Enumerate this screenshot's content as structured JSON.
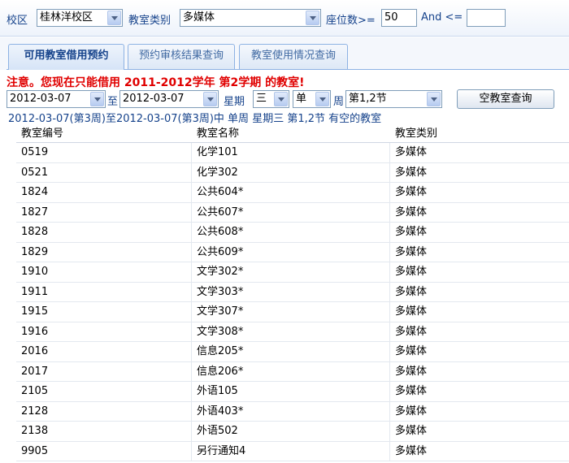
{
  "filters": {
    "campus_label": "校区",
    "campus_value": "桂林洋校区",
    "room_type_label": "教室类别",
    "room_type_value": "多媒体",
    "seats_label": "座位数>=",
    "seats_min": "50",
    "and_label": "And <=",
    "seats_max": ""
  },
  "tabs": [
    {
      "label": "可用教室借用预约",
      "active": true
    },
    {
      "label": "预约审核结果查询",
      "active": false
    },
    {
      "label": "教室使用情况查询",
      "active": false
    }
  ],
  "notice": "注意。您现在只能借用 2011-2012学年 第2学期 的教室!",
  "query": {
    "start_date": "2012-03-07",
    "to_label": "至",
    "end_date": "2012-03-07",
    "weekday_label": "星期",
    "weekday_value": "三",
    "week_type_value": "单",
    "week_label": "周",
    "period_value": "第1,2节",
    "search_button": "空教室查询"
  },
  "summary": "2012-03-07(第3周)至2012-03-07(第3周)中 单周 星期三 第1,2节 有空的教室",
  "table": {
    "headers": [
      "教室编号",
      "教室名称",
      "教室类别"
    ],
    "rows": [
      [
        "0519",
        "化学101",
        "多媒体"
      ],
      [
        "0521",
        "化学302",
        "多媒体"
      ],
      [
        "1824",
        "公共604*",
        "多媒体"
      ],
      [
        "1827",
        "公共607*",
        "多媒体"
      ],
      [
        "1828",
        "公共608*",
        "多媒体"
      ],
      [
        "1829",
        "公共609*",
        "多媒体"
      ],
      [
        "1910",
        "文学302*",
        "多媒体"
      ],
      [
        "1911",
        "文学303*",
        "多媒体"
      ],
      [
        "1915",
        "文学307*",
        "多媒体"
      ],
      [
        "1916",
        "文学308*",
        "多媒体"
      ],
      [
        "2016",
        "信息205*",
        "多媒体"
      ],
      [
        "2017",
        "信息206*",
        "多媒体"
      ],
      [
        "2105",
        "外语105",
        "多媒体"
      ],
      [
        "2128",
        "外语403*",
        "多媒体"
      ],
      [
        "2138",
        "外语502",
        "多媒体"
      ],
      [
        "9905",
        "另行通知4",
        "多媒体"
      ]
    ]
  }
}
